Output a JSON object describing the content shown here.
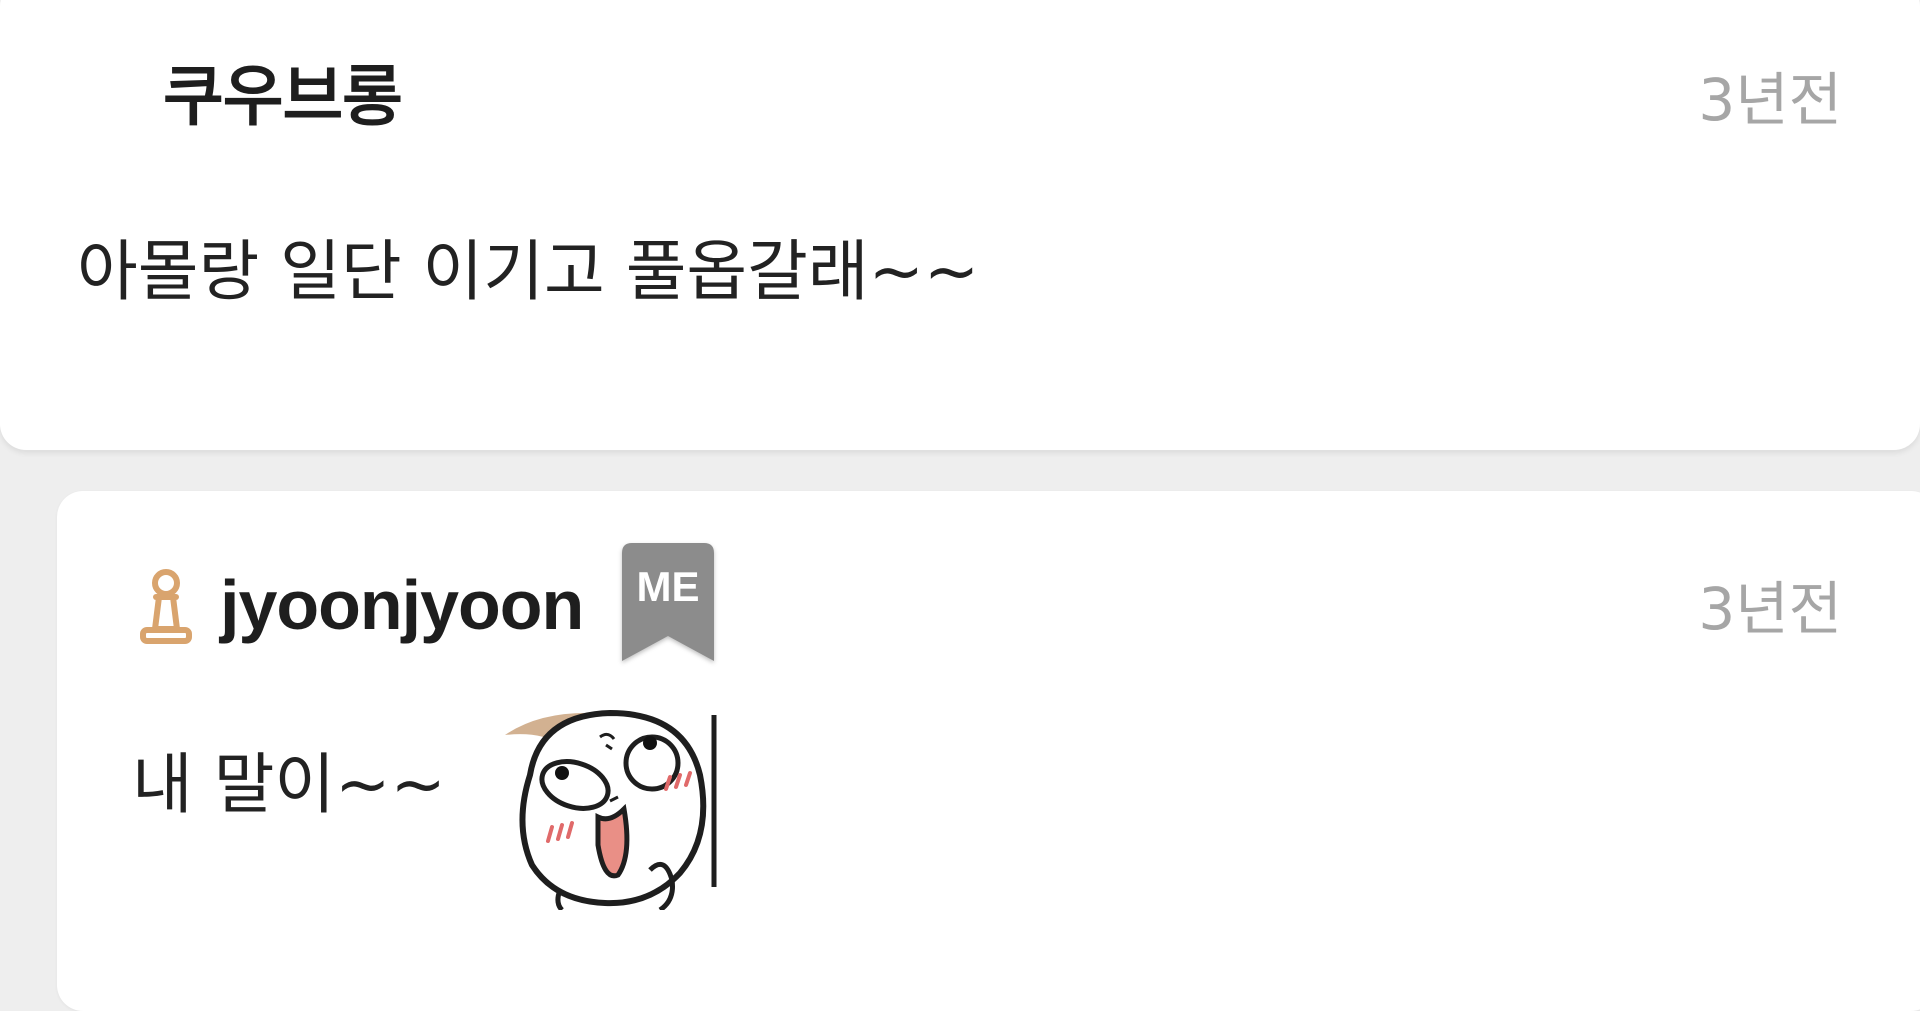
{
  "comments": [
    {
      "username": "쿠우브롱",
      "time": "3년전",
      "message": "아몰랑 일단 이기고 풀옵갈래~~"
    },
    {
      "username": "jyoonjyoon",
      "time": "3년전",
      "badge": "ME",
      "message": "내 말이~~",
      "rank_icon": "pawn-icon",
      "sticker": "laughing-face-emoticon"
    }
  ],
  "colors": {
    "background": "#eeeeee",
    "card": "#ffffff",
    "text": "#222222",
    "timestamp": "#a6a6a6",
    "rank_icon": "#d9a46e",
    "badge": "#8c8c8c"
  }
}
